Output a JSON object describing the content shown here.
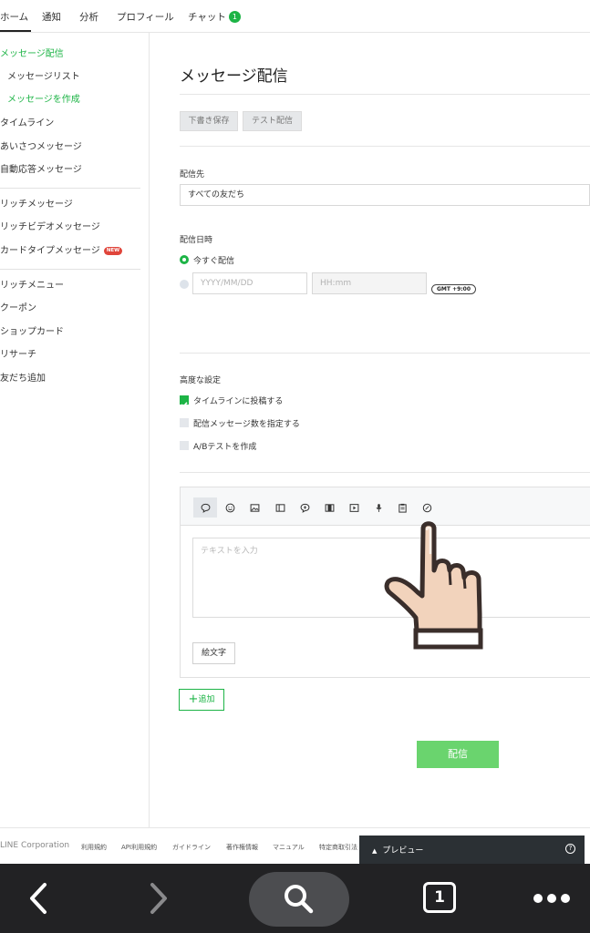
{
  "topnav": {
    "tabs": [
      {
        "label": "ホーム"
      },
      {
        "label": "通知"
      },
      {
        "label": "分析"
      },
      {
        "label": "プロフィール"
      },
      {
        "label": "チャット"
      }
    ],
    "chat_badge": "1"
  },
  "sidebar": {
    "items": [
      {
        "label": "メッセージ配信"
      },
      {
        "label": "メッセージリスト"
      },
      {
        "label": "メッセージを作成"
      },
      {
        "label": "タイムライン"
      },
      {
        "label": "あいさつメッセージ"
      },
      {
        "label": "自動応答メッセージ"
      },
      {
        "label": "リッチメッセージ"
      },
      {
        "label": "リッチビデオメッセージ"
      },
      {
        "label": "カードタイプメッセージ"
      },
      {
        "label": "リッチメニュー"
      },
      {
        "label": "クーポン"
      },
      {
        "label": "ショップカード"
      },
      {
        "label": "リサーチ"
      },
      {
        "label": "友だち追加"
      }
    ],
    "new_badge": "NEW"
  },
  "main": {
    "title": "メッセージ配信",
    "draft_button": "下書き保存",
    "test_button": "テスト配信",
    "recipient_label": "配信先",
    "recipient_value": "すべての友だち",
    "schedule_label": "配信日時",
    "now_option": "今すぐ配信",
    "date_placeholder": "YYYY/MM/DD",
    "time_placeholder": "HH:mm",
    "gmt": "GMT +9:00",
    "advanced_label": "高度な設定",
    "options": [
      {
        "label": "タイムラインに投稿する",
        "checked": true
      },
      {
        "label": "配信メッセージ数を指定する",
        "checked": false
      },
      {
        "label": "A/Bテストを作成",
        "checked": false
      }
    ],
    "editor": {
      "tools": [
        "speech-bubble-icon",
        "smiley-icon",
        "image-icon",
        "card-icon",
        "chat-plus-icon",
        "film-icon",
        "play-icon",
        "microphone-icon",
        "clipboard-icon",
        "chat-circle-icon"
      ],
      "text_placeholder": "テキストを入力",
      "emoji_button": "絵文字"
    },
    "add_button": "追加",
    "deliver_button": "配信"
  },
  "footer": {
    "copyright": "LINE Corporation",
    "links": [
      "利用規約",
      "API利用規約",
      "ガイドライン",
      "著作権情報",
      "マニュアル",
      "特定商取引法"
    ]
  },
  "preview": {
    "label": "プレビュー",
    "help": "?"
  },
  "browser": {
    "tab_count": "1"
  },
  "colors": {
    "accent": "#1db446",
    "deliver": "#6ad46e",
    "preview_bg": "#2b3034",
    "browser_bar": "#222224"
  }
}
